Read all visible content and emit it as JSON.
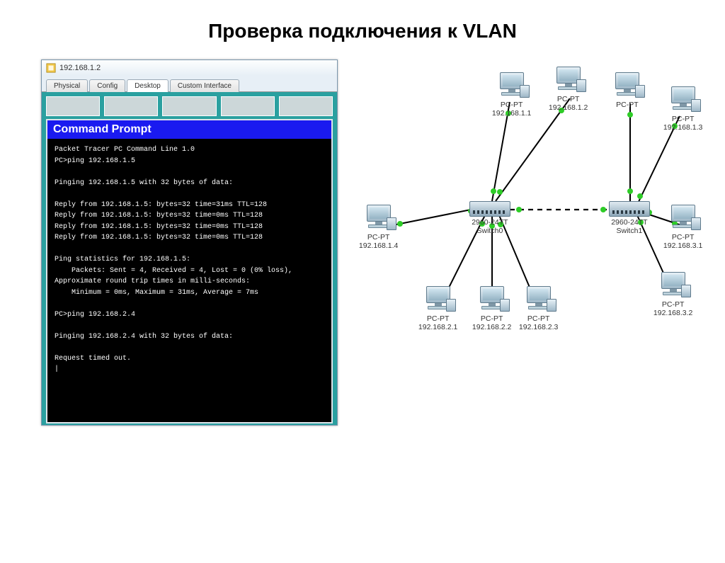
{
  "slide": {
    "title": "Проверка подключения к VLAN"
  },
  "window": {
    "title": "192.168.1.2",
    "tabs": [
      "Physical",
      "Config",
      "Desktop",
      "Custom Interface"
    ],
    "active_tab": "Desktop"
  },
  "command_prompt": {
    "title": "Command Prompt",
    "lines": [
      "Packet Tracer PC Command Line 1.0",
      "PC>ping 192.168.1.5",
      "",
      "Pinging 192.168.1.5 with 32 bytes of data:",
      "",
      "Reply from 192.168.1.5: bytes=32 time=31ms TTL=128",
      "Reply from 192.168.1.5: bytes=32 time=0ms TTL=128",
      "Reply from 192.168.1.5: bytes=32 time=0ms TTL=128",
      "Reply from 192.168.1.5: bytes=32 time=0ms TTL=128",
      "",
      "Ping statistics for 192.168.1.5:",
      "    Packets: Sent = 4, Received = 4, Lost = 0 (0% loss),",
      "Approximate round trip times in milli-seconds:",
      "    Minimum = 0ms, Maximum = 31ms, Average = 7ms",
      "",
      "PC>ping 192.168.2.4",
      "",
      "Pinging 192.168.2.4 with 32 bytes of data:",
      "",
      "Request timed out.",
      "|"
    ]
  },
  "topology": {
    "switches": [
      {
        "name": "2960-24TT",
        "label": "Switch0"
      },
      {
        "name": "2960-24TT",
        "label": "Switch1"
      }
    ],
    "pcs": [
      {
        "type": "PC-PT",
        "ip": "192.168.1.1"
      },
      {
        "type": "PC-PT",
        "ip": "192.168.1.2"
      },
      {
        "type": "PC-PT",
        "ip": "192.168.1.3"
      },
      {
        "type": "PC-PT",
        "ip": "192.168.1.4"
      },
      {
        "type": "PC-PT",
        "ip": "192.168.2.1"
      },
      {
        "type": "PC-PT",
        "ip": "192.168.2.2"
      },
      {
        "type": "PC-PT",
        "ip": "192.168.2.3"
      },
      {
        "type": "PC-PT",
        "ip": "192.168.3.1"
      },
      {
        "type": "PC-PT",
        "ip": "192.168.3.2"
      }
    ]
  }
}
